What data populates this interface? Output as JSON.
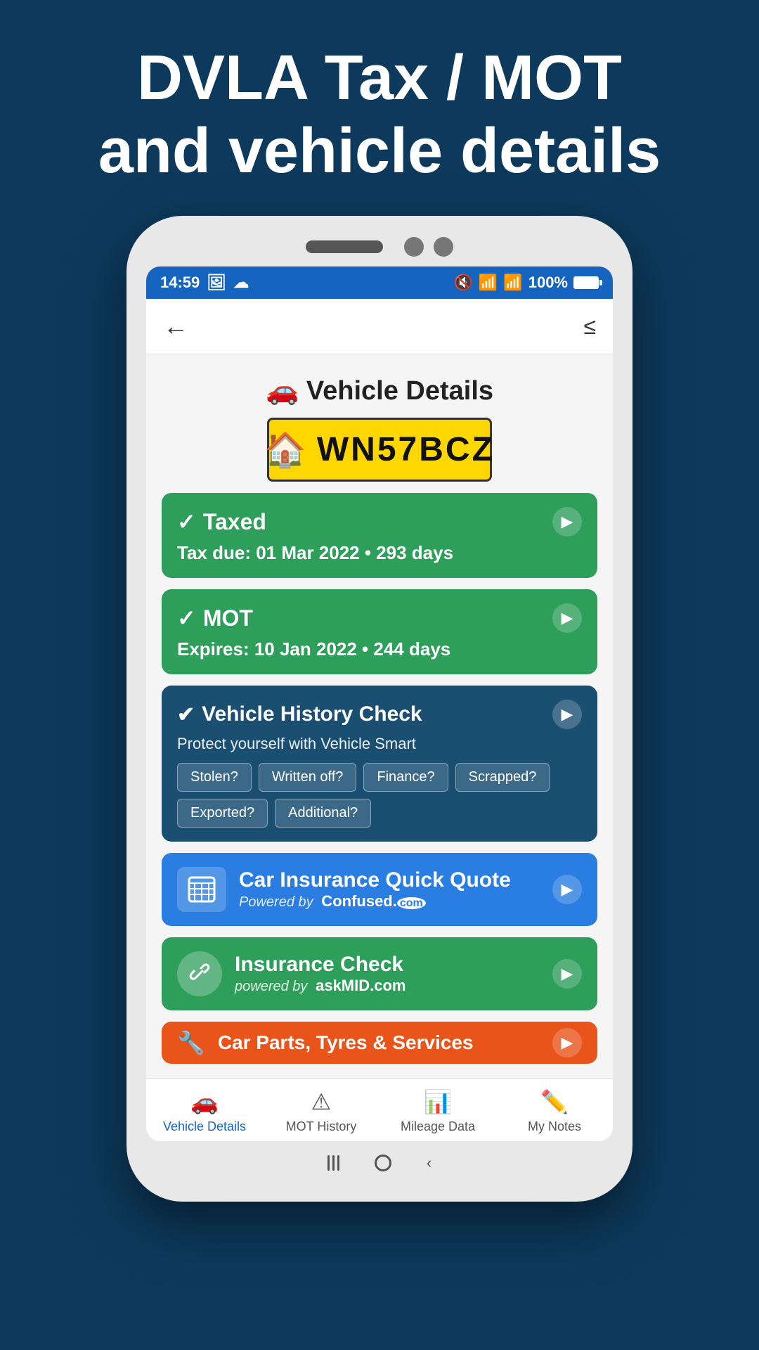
{
  "page_header": {
    "line1": "DVLA Tax / MOT",
    "line2": "and vehicle details"
  },
  "status_bar": {
    "time": "14:59",
    "battery": "100%"
  },
  "app_bar": {
    "back_label": "←",
    "share_label": "⋮"
  },
  "page_title": "Vehicle Details",
  "number_plate": {
    "icon": "🏠",
    "value": "WN57BCZ"
  },
  "tax_card": {
    "check_icon": "✓",
    "title": "Taxed",
    "subtitle": "Tax due: 01 Mar 2022 • 293 days"
  },
  "mot_card": {
    "check_icon": "✓",
    "title": "MOT",
    "subtitle": "Expires: 10 Jan 2022 • 244 days"
  },
  "history_check_card": {
    "shield_icon": "✔",
    "title": "Vehicle History Check",
    "subtitle": "Protect yourself with Vehicle Smart",
    "tags": [
      "Stolen?",
      "Written off?",
      "Finance?",
      "Scrapped?",
      "Exported?",
      "Additional?"
    ]
  },
  "car_insurance_card": {
    "icon": "🖩",
    "title": "Car Insurance Quick Quote",
    "powered_by": "Powered by",
    "brand": "Confused.",
    "brand_suffix": "com"
  },
  "insurance_check_card": {
    "icon": "🔗",
    "title": "Insurance Check",
    "powered_by": "powered by",
    "brand": "askMID.com"
  },
  "orange_card": {
    "title": "Car Parts, Tyres & Services"
  },
  "bottom_nav": {
    "items": [
      {
        "id": "vehicle-details",
        "icon": "🚗",
        "label": "Vehicle Details",
        "active": true
      },
      {
        "id": "mot-history",
        "icon": "⚠",
        "label": "MOT History",
        "active": false
      },
      {
        "id": "mileage-data",
        "icon": "📊",
        "label": "Mileage Data",
        "active": false
      },
      {
        "id": "my-notes",
        "icon": "✏️",
        "label": "My Notes",
        "active": false
      }
    ]
  }
}
